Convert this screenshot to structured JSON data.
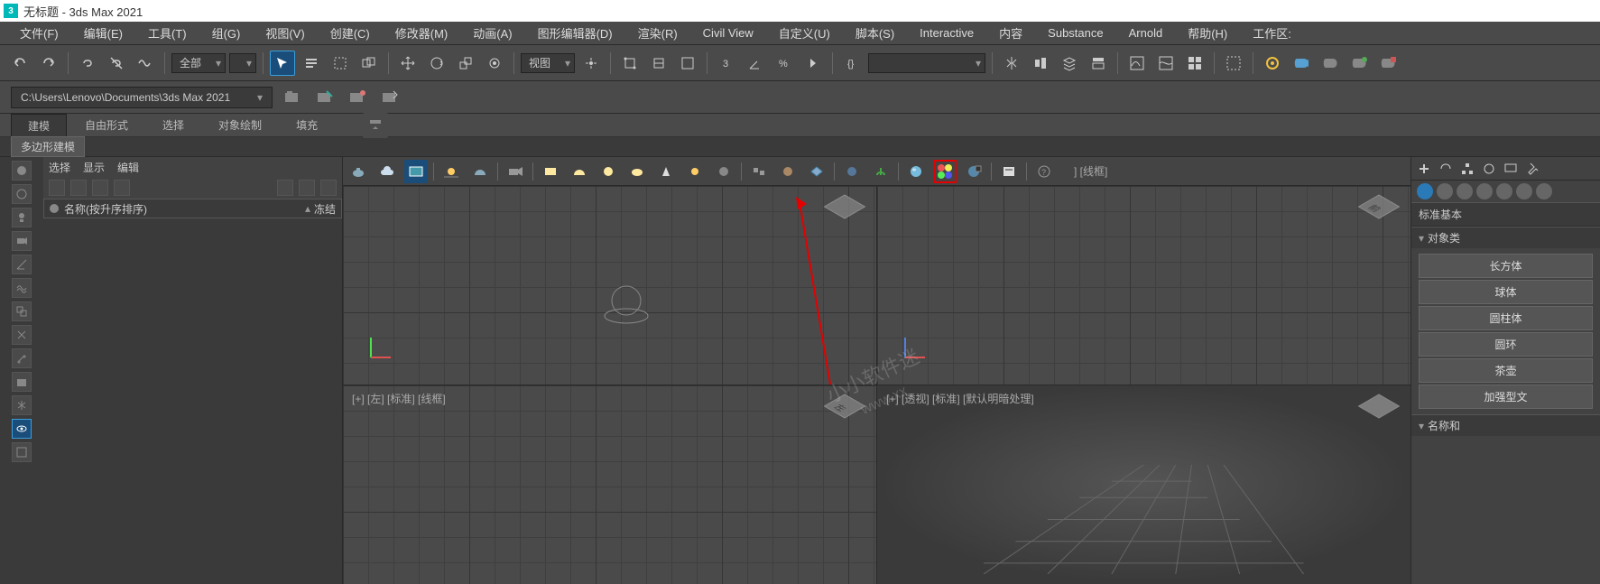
{
  "title": "无标题 - 3ds Max 2021",
  "app_icon_text": "3",
  "menubar": [
    "文件(F)",
    "编辑(E)",
    "工具(T)",
    "组(G)",
    "视图(V)",
    "创建(C)",
    "修改器(M)",
    "动画(A)",
    "图形编辑器(D)",
    "渲染(R)",
    "Civil View",
    "自定义(U)",
    "脚本(S)",
    "Interactive",
    "内容",
    "Substance",
    "Arnold",
    "帮助(H)",
    "工作区:"
  ],
  "toolbar": {
    "selection_set": "全部",
    "dd": "",
    "view_dd": "视图"
  },
  "path": "C:\\Users\\Lenovo\\Documents\\3ds Max 2021",
  "ribbon": {
    "tabs": [
      "建模",
      "自由形式",
      "选择",
      "对象绘制",
      "填充"
    ],
    "sub": "多边形建模"
  },
  "left": {
    "tabs": [
      "选择",
      "显示",
      "编辑"
    ],
    "name_col": "名称(按升序排序)",
    "freeze_col": "冻结"
  },
  "viewports": {
    "top": "] [线框]",
    "left": "[+] [左] [标准] [线框]",
    "front_cube": "前",
    "left_cube": "左",
    "persp": "[+] [透视] [标准] [默认明暗处理]"
  },
  "right": {
    "prim_header": "标准基本",
    "obj_header": "对象类",
    "buttons": [
      "长方体",
      "球体",
      "圆柱体",
      "圆环",
      "茶壶",
      "加强型文"
    ],
    "name_rollout": "名称和"
  },
  "watermark1": "小小软件迷",
  "watermark2": "www.xx"
}
